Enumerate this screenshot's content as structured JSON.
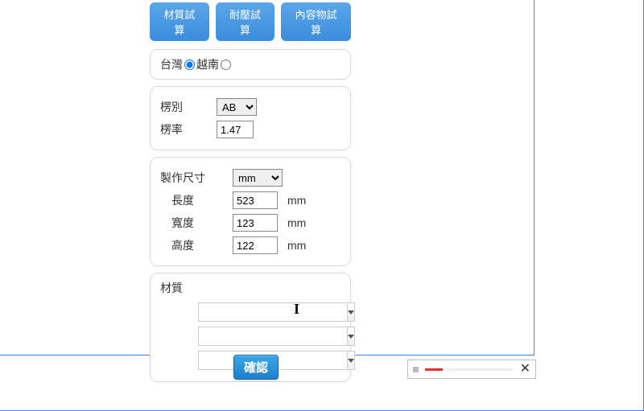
{
  "tabs": {
    "material": "材質試算",
    "pressure": "耐壓試算",
    "content": "內容物試算"
  },
  "region": {
    "taiwan": "台灣",
    "vietnam": "越南"
  },
  "flute": {
    "label_type": "楞別",
    "type_value": "AB",
    "label_rate": "楞率",
    "rate_value": "1.47"
  },
  "size": {
    "title": "製作尺寸",
    "unit_sel": "mm",
    "len_label": "長度",
    "len_value": "523",
    "wid_label": "寬度",
    "wid_value": "123",
    "hei_label": "高度",
    "hei_value": "122",
    "unit_suffix": "mm"
  },
  "material": {
    "title": "材質",
    "row1": "",
    "row2": "",
    "row3": ""
  },
  "confirm_label": "確認",
  "player": {
    "close": "✕"
  }
}
